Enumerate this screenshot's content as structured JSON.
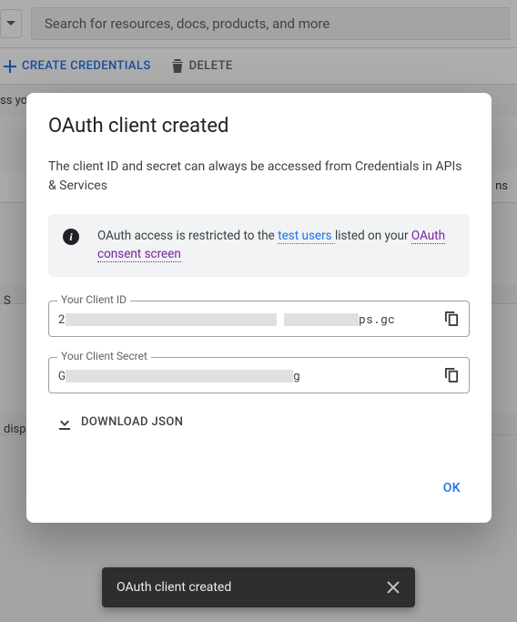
{
  "topbar": {
    "search_placeholder": "Search for resources, docs, products, and more"
  },
  "actionbar": {
    "create_label": "CREATE CREDENTIALS",
    "delete_label": "DELETE"
  },
  "background": {
    "frag_left_1": "ss you",
    "frag_right_1": "ns",
    "frag_left_2": "S",
    "frag_left_3": "displa"
  },
  "dialog": {
    "title": "OAuth client created",
    "lead": "The client ID and secret can always be accessed from Credentials in APIs & Services",
    "info_prefix": "OAuth access is restricted to the ",
    "info_link1": "test users ",
    "info_mid": "listed on your ",
    "info_link2": "OAuth consent screen",
    "client_id_label": "Your Client ID",
    "client_id_prefix": "2",
    "client_id_suffix": "ps.gc",
    "client_secret_label": "Your Client Secret",
    "client_secret_prefix": "G",
    "client_secret_suffix": "g",
    "download_label": "DOWNLOAD JSON",
    "ok_label": "OK"
  },
  "toast": {
    "message": "OAuth client created"
  }
}
